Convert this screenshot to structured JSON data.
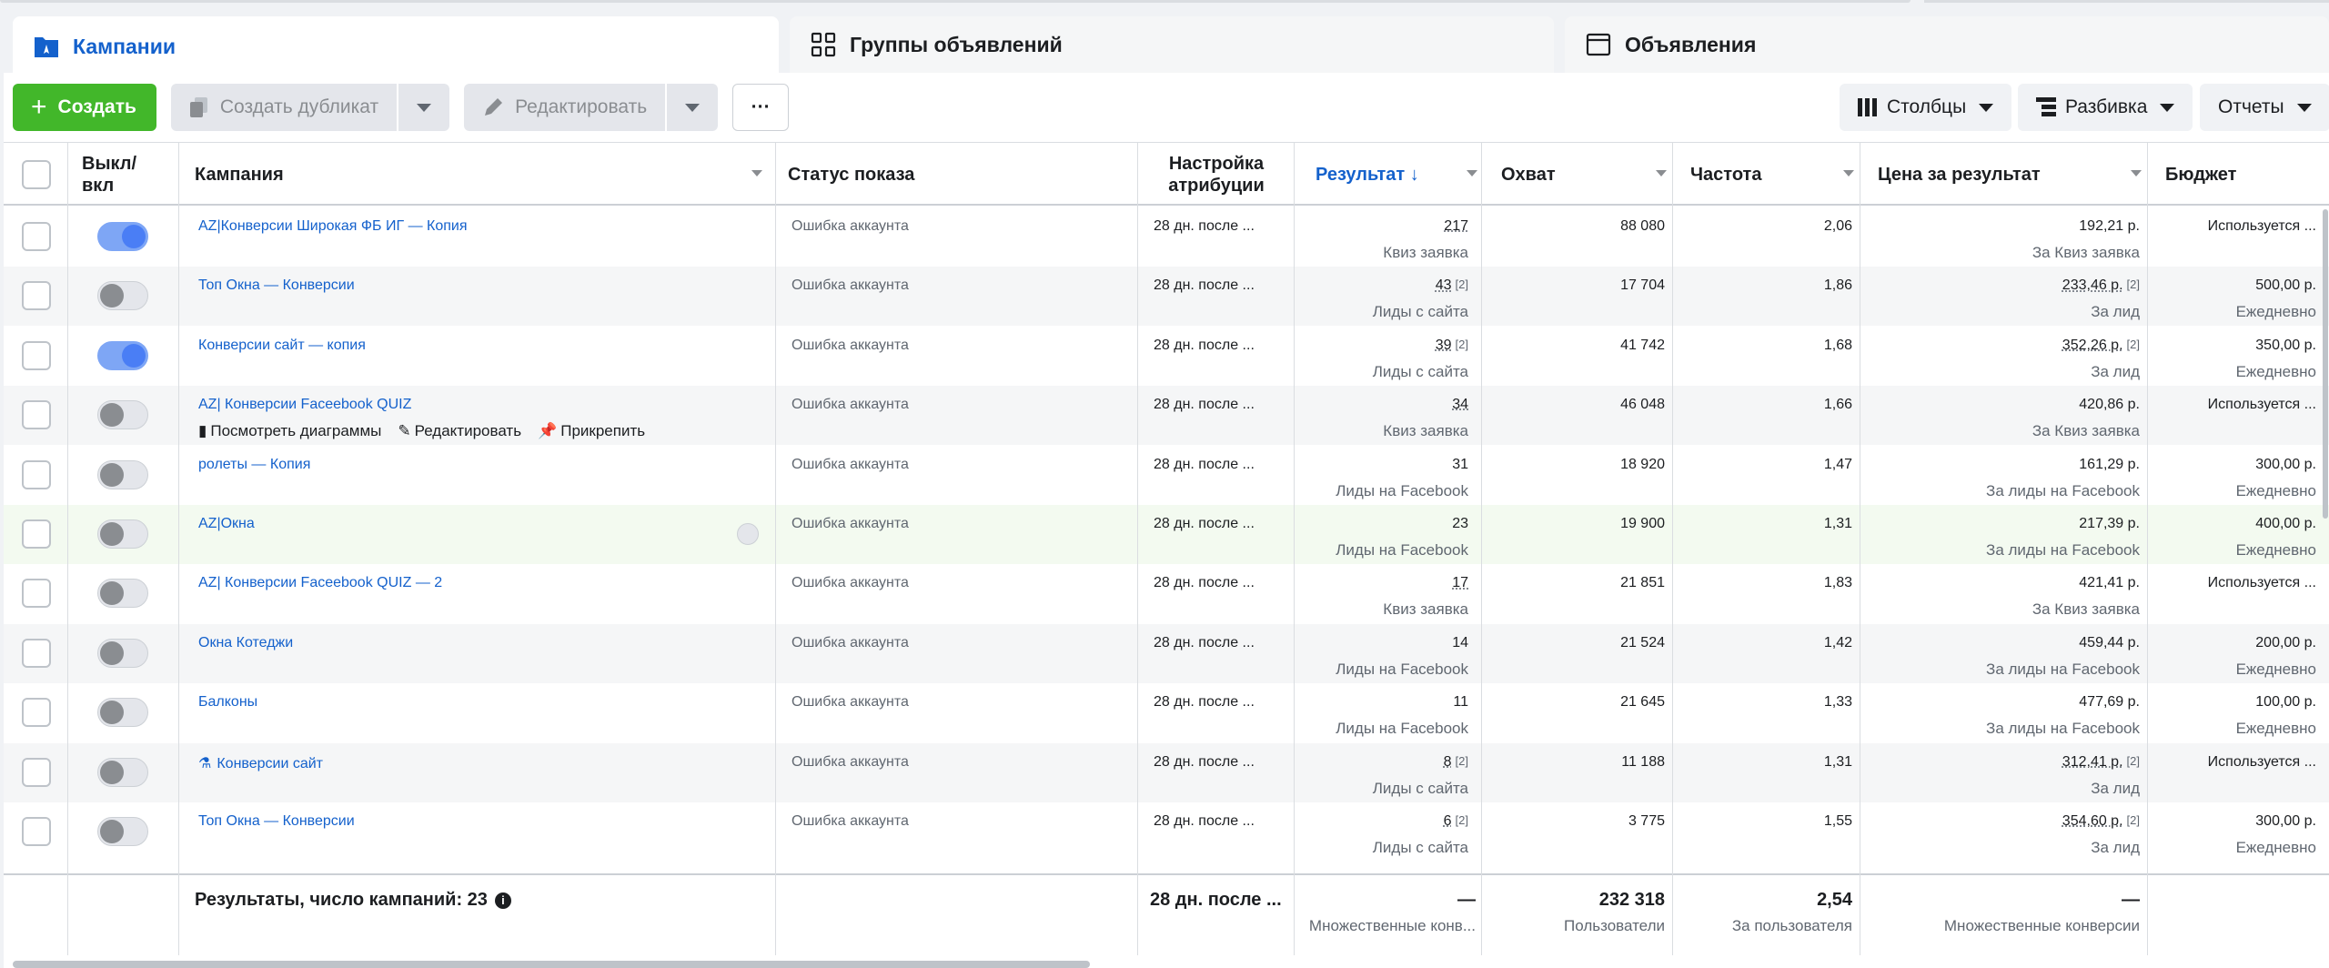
{
  "tabs": [
    {
      "label": "Кампании",
      "icon": "folder-flag-icon"
    },
    {
      "label": "Группы объявлений",
      "icon": "grid-icon"
    },
    {
      "label": "Объявления",
      "icon": "ad-window-icon"
    }
  ],
  "toolbar": {
    "create_label": "Создать",
    "duplicate_label": "Создать дубликат",
    "edit_label": "Редактировать",
    "more_label": "···",
    "columns_label": "Столбцы",
    "breakdown_label": "Разбивка",
    "reports_label": "Отчеты"
  },
  "columns": {
    "toggle": "Выкл/ вкл",
    "campaign": "Кампания",
    "status": "Статус показа",
    "attribution": "Настройка атрибуции",
    "result": "Результат ↓",
    "reach": "Охват",
    "frequency": "Частота",
    "cost": "Цена за результат",
    "budget": "Бюджет"
  },
  "row_actions": {
    "charts": "Посмотреть диаграммы",
    "edit": "Редактировать",
    "pin": "Прикрепить"
  },
  "rows": [
    {
      "name": "AZ|Конверсии Широкая ФБ ИГ — Копия",
      "on": true,
      "status": "Ошибка аккаунта",
      "attribution": "28 дн. после ...",
      "result": "217",
      "result_sup": "",
      "result_sub": "Квиз заявка",
      "reach": "88 080",
      "freq": "2,06",
      "cost": "192,21 р.",
      "cost_sup": "",
      "cost_sub": "За Квиз заявка",
      "budget": "Используется ...",
      "budget_sub": ""
    },
    {
      "name": "Топ Окна — Конверсии",
      "on": false,
      "status": "Ошибка аккаунта",
      "attribution": "28 дн. после ...",
      "result": "43",
      "result_sup": "[2]",
      "result_sub": "Лиды с сайта",
      "reach": "17 704",
      "freq": "1,86",
      "cost": "233,46 р.",
      "cost_sup": "[2]",
      "cost_sub": "За лид",
      "budget": "500,00 р.",
      "budget_sub": "Ежедневно"
    },
    {
      "name": "Конверсии сайт — копия",
      "on": true,
      "status": "Ошибка аккаунта",
      "attribution": "28 дн. после ...",
      "result": "39",
      "result_sup": "[2]",
      "result_sub": "Лиды с сайта",
      "reach": "41 742",
      "freq": "1,68",
      "cost": "352,26 р.",
      "cost_sup": "[2]",
      "cost_sub": "За лид",
      "budget": "350,00 р.",
      "budget_sub": "Ежедневно"
    },
    {
      "name": "AZ| Конверсии Faceebook QUIZ",
      "on": false,
      "status": "Ошибка аккаунта",
      "attribution": "28 дн. после ...",
      "result": "34",
      "result_sup": "",
      "result_sub": "Квиз заявка",
      "reach": "46 048",
      "freq": "1,66",
      "cost": "420,86 р.",
      "cost_sup": "",
      "cost_sub": "За Квиз заявка",
      "budget": "Используется ...",
      "budget_sub": ""
    },
    {
      "name": "ролеты — Копия",
      "on": false,
      "status": "Ошибка аккаунта",
      "attribution": "28 дн. после ...",
      "result": "31",
      "result_sup": "",
      "result_sub": "Лиды на Facebook",
      "reach": "18 920",
      "freq": "1,47",
      "cost": "161,29 р.",
      "cost_sup": "",
      "cost_sub": "За лиды на Facebook",
      "budget": "300,00 р.",
      "budget_sub": "Ежедневно"
    },
    {
      "name": "AZ|Окна",
      "on": false,
      "status": "Ошибка аккаунта",
      "attribution": "28 дн. после ...",
      "result": "23",
      "result_sup": "",
      "result_sub": "Лиды на Facebook",
      "reach": "19 900",
      "freq": "1,31",
      "cost": "217,39 р.",
      "cost_sup": "",
      "cost_sub": "За лиды на Facebook",
      "budget": "400,00 р.",
      "budget_sub": "Ежедневно"
    },
    {
      "name": "AZ| Конверсии Faceebook QUIZ — 2",
      "on": false,
      "status": "Ошибка аккаунта",
      "attribution": "28 дн. после ...",
      "result": "17",
      "result_sup": "",
      "result_sub": "Квиз заявка",
      "reach": "21 851",
      "freq": "1,83",
      "cost": "421,41 р.",
      "cost_sup": "",
      "cost_sub": "За Квиз заявка",
      "budget": "Используется ...",
      "budget_sub": ""
    },
    {
      "name": "Окна Котеджи",
      "on": false,
      "status": "Ошибка аккаунта",
      "attribution": "28 дн. после ...",
      "result": "14",
      "result_sup": "",
      "result_sub": "Лиды на Facebook",
      "reach": "21 524",
      "freq": "1,42",
      "cost": "459,44 р.",
      "cost_sup": "",
      "cost_sub": "За лиды на Facebook",
      "budget": "200,00 р.",
      "budget_sub": "Ежедневно"
    },
    {
      "name": "Балконы",
      "on": false,
      "status": "Ошибка аккаунта",
      "attribution": "28 дн. после ...",
      "result": "11",
      "result_sup": "",
      "result_sub": "Лиды на Facebook",
      "reach": "21 645",
      "freq": "1,33",
      "cost": "477,69 р.",
      "cost_sup": "",
      "cost_sub": "За лиды на Facebook",
      "budget": "100,00 р.",
      "budget_sub": "Ежедневно"
    },
    {
      "name": "Конверсии сайт",
      "on": false,
      "status": "Ошибка аккаунта",
      "attribution": "28 дн. после ...",
      "result": "8",
      "result_sup": "[2]",
      "result_sub": "Лиды с сайта",
      "reach": "11 188",
      "freq": "1,31",
      "cost": "312,41 р.",
      "cost_sup": "[2]",
      "cost_sub": "За лид",
      "budget": "Используется ...",
      "budget_sub": ""
    },
    {
      "name": "Топ Окна — Конверсии",
      "on": false,
      "status": "Ошибка аккаунта",
      "attribution": "28 дн. после ...",
      "result": "6",
      "result_sup": "[2]",
      "result_sub": "Лиды с сайта",
      "reach": "3 775",
      "freq": "1,55",
      "cost": "354,60 р.",
      "cost_sup": "[2]",
      "cost_sub": "За лид",
      "budget": "300,00 р.",
      "budget_sub": "Ежедневно"
    }
  ],
  "footer": {
    "label": "Результаты, число кампаний: 23",
    "attribution": "28 дн. после ...",
    "result": "—",
    "result_sub": "Множественные конв...",
    "reach": "232 318",
    "reach_sub": "Пользователи",
    "freq": "2,54",
    "freq_sub": "За пользователя",
    "cost": "—",
    "cost_sub": "Множественные конверсии"
  },
  "colors": {
    "accent": "#1461cc",
    "create": "#42b72a"
  }
}
